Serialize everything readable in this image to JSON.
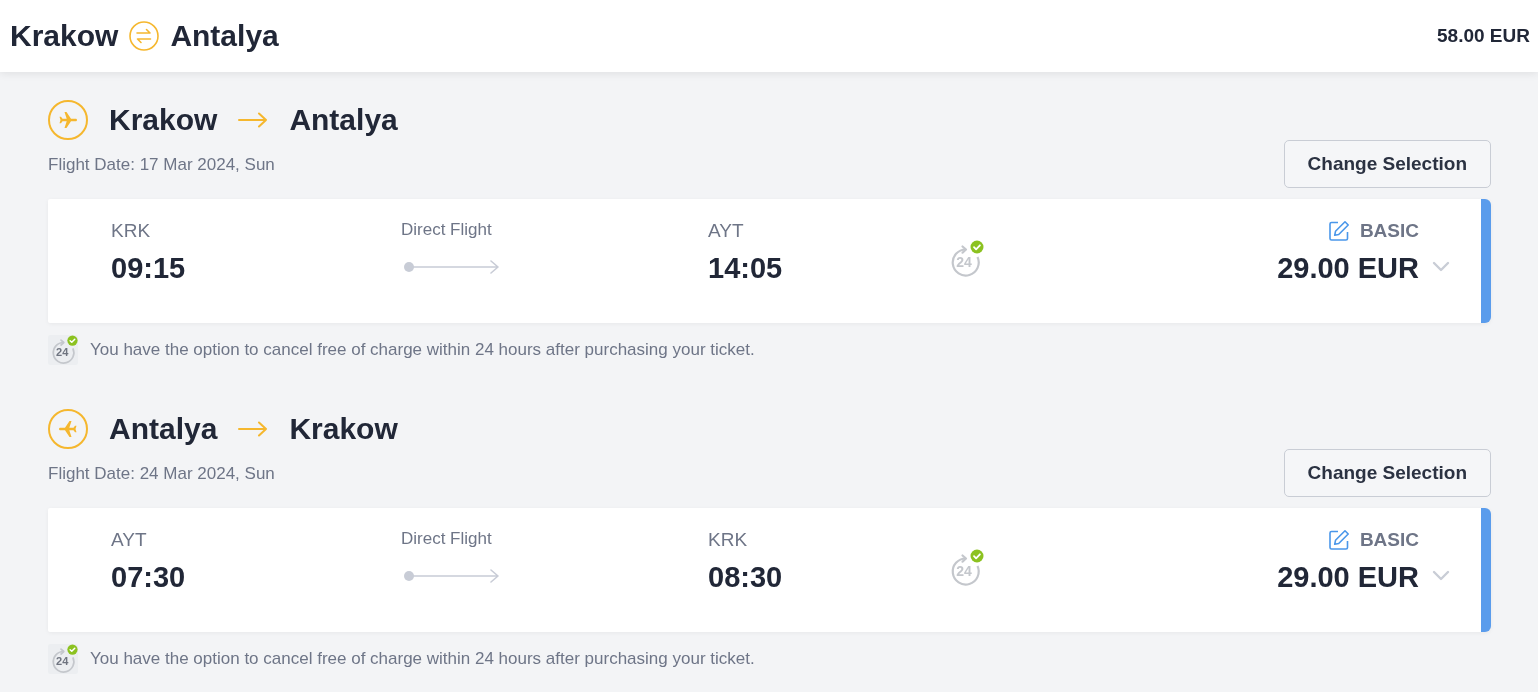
{
  "header": {
    "origin": "Krakow",
    "destination": "Antalya",
    "total_price": "58.00 EUR"
  },
  "legs": [
    {
      "kind": "outbound",
      "origin": "Krakow",
      "destination": "Antalya",
      "flight_date": "Flight Date: 17 Mar 2024, Sun",
      "change_button": "Change Selection",
      "departure_code": "KRK",
      "departure_time": "09:15",
      "flight_type": "Direct Flight",
      "arrival_code": "AYT",
      "arrival_time": "14:05",
      "cancel_badge": "24",
      "fare_class": "BASIC",
      "price": "29.00 EUR",
      "selected": true,
      "expanded": false,
      "note_badge": "24",
      "cancellation_note": "You have the option to cancel free of charge within 24 hours after purchasing your ticket."
    },
    {
      "kind": "return",
      "origin": "Antalya",
      "destination": "Krakow",
      "flight_date": "Flight Date: 24 Mar 2024, Sun",
      "change_button": "Change Selection",
      "departure_code": "AYT",
      "departure_time": "07:30",
      "flight_type": "Direct Flight",
      "arrival_code": "KRK",
      "arrival_time": "08:30",
      "cancel_badge": "24",
      "fare_class": "BASIC",
      "price": "29.00 EUR",
      "selected": true,
      "expanded": false,
      "note_badge": "24",
      "cancellation_note": "You have the option to cancel free of charge within 24 hours after purchasing your ticket."
    }
  ]
}
